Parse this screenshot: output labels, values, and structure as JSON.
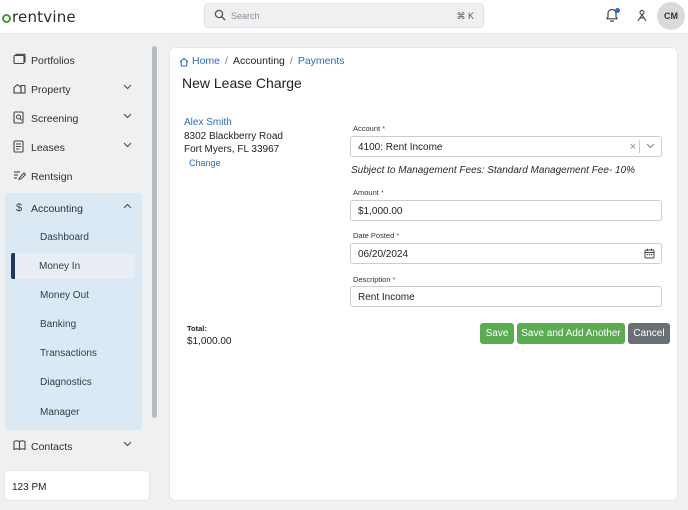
{
  "brand": {
    "logo_text": "rentvine",
    "accent": "#3f9a3f"
  },
  "header": {
    "search_placeholder": "Search",
    "search_shortcut": "⌘ K",
    "avatar_initials": "CM",
    "notification_dot_color": "#2d6fbd"
  },
  "sidebar": {
    "items": [
      {
        "label": "Portfolios",
        "icon": "portfolio-icon",
        "expandable": false
      },
      {
        "label": "Property",
        "icon": "property-icon",
        "expandable": true
      },
      {
        "label": "Screening",
        "icon": "screening-icon",
        "expandable": true
      },
      {
        "label": "Leases",
        "icon": "leases-icon",
        "expandable": true
      },
      {
        "label": "Rentsign",
        "icon": "rentsign-icon",
        "expandable": false
      }
    ],
    "accounting": {
      "label": "Accounting",
      "icon": "dollar-icon",
      "expanded": true,
      "sub_items": [
        {
          "label": "Dashboard",
          "active": false
        },
        {
          "label": "Money In",
          "active": true
        },
        {
          "label": "Money Out",
          "active": false
        },
        {
          "label": "Banking",
          "active": false
        },
        {
          "label": "Transactions",
          "active": false
        },
        {
          "label": "Diagnostics",
          "active": false
        },
        {
          "label": "Manager",
          "active": false
        }
      ]
    },
    "contacts": {
      "label": "Contacts",
      "icon": "contacts-icon"
    },
    "time_display": "123 PM"
  },
  "breadcrumb": {
    "items": [
      {
        "label": "Home",
        "link": true
      },
      {
        "label": "Accounting",
        "link": false
      },
      {
        "label": "Payments",
        "link": true
      }
    ]
  },
  "page_title": "New Lease Charge",
  "tenant": {
    "name": "Alex Smith",
    "address_line1": "8302 Blackberry Road",
    "address_line2": "Fort Myers, FL 33967",
    "change_label": "Change"
  },
  "form": {
    "account": {
      "label": "Account",
      "value": "4100: Rent Income"
    },
    "management_note": "Subject to Management Fees: Standard Management Fee- 10%",
    "amount": {
      "label": "Amount",
      "value": "$1,000.00"
    },
    "date_posted": {
      "label": "Date Posted",
      "value": "06/20/2024"
    },
    "description": {
      "label": "Description",
      "value": "Rent Income"
    }
  },
  "total": {
    "label": "Total:",
    "value": "$1,000.00"
  },
  "buttons": {
    "save": "Save",
    "save_add": "Save and Add Another",
    "cancel": "Cancel"
  }
}
